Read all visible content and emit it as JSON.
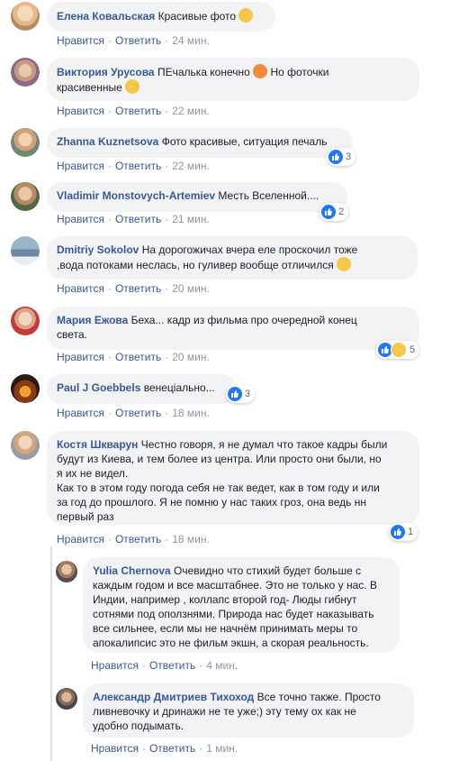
{
  "comments": [
    {
      "author": "Елена Ковальская",
      "text": "Красивые фото",
      "emoji": "slightly-smiling-emoji",
      "like": "Нравится",
      "reply": "Ответить",
      "time": "24 мин."
    },
    {
      "author": "Виктория Урусова",
      "text": "ПЕчалька конечно",
      "text2": "Но фоточки",
      "text3": "красивенные",
      "emoji": "persevering-emoji",
      "emoji2": "grinning-emoji",
      "like": "Нравится",
      "reply": "Ответить",
      "time": "22 мин."
    },
    {
      "author": "Zhanna Kuznetsova",
      "text": "Фото красивые, ситуация печаль",
      "like": "Нравится",
      "reply": "Ответить",
      "time": "22 мин.",
      "reactions": "3"
    },
    {
      "author": "Vladimir Monstovych-Artemiev",
      "text": "Месть Вселенной....",
      "like": "Нравится",
      "reply": "Ответить",
      "time": "21 мин.",
      "reactions": "2"
    },
    {
      "author": "Dmitriy Sokolov",
      "text": "На дорогожичах вчера еле проскочил тоже",
      "text2": ",вода потоками неслась, но гуливер вообще отличился",
      "emoji": "confused-emoji",
      "like": "Нравится",
      "reply": "Ответить",
      "time": "20 мин."
    },
    {
      "author": "Мария Ежова",
      "text": "Беха... кадр из фильма про очередной конец",
      "text2": "света.",
      "like": "Нравится",
      "reply": "Ответить",
      "time": "20 мин.",
      "reactions": "5"
    },
    {
      "author": "Paul J Goebbels",
      "text": "венеціально...",
      "like": "Нравится",
      "reply": "Ответить",
      "time": "18 мин.",
      "reactions": "3"
    },
    {
      "author": "Костя Шкварун",
      "lines": [
        "Честно говоря, я не думал что такое кадры были",
        "будут из Киева, и тем более из центра. Или просто они были, но",
        "я их не видел.",
        "Как то в этом году погода себя не так ведет, как в том году и или",
        "за год до прошлого. Я не помню у нас таких гроз, она ведь нн",
        "первый раз"
      ],
      "like": "Нравится",
      "reply": "Ответить",
      "time": "18 мин.",
      "reactions": "1"
    }
  ],
  "replies": [
    {
      "author": "Yulia Chernova",
      "lines": [
        "Очевидно что стихий будет больше с",
        "каждым годом и все масштабнее. Это не только у нас. В",
        "Индии, например , коллапс второй год- Люды гибнут",
        "сотнями под оползнями. Природа нас будет наказывать",
        "все сильнее, если мы не начнём принимать меры то",
        "апокалипсис это не фильм экшн, а скорая реальность."
      ],
      "like": "Нравится",
      "reply": "Ответить",
      "time": "4 мин."
    },
    {
      "author": "Александр Дмитриев Тихоход",
      "lines": [
        "Все точно также. Просто",
        "ливневочку и дринажи не те уже;) эту тему ох как не",
        "удобно подымать."
      ],
      "like": "Нравится",
      "reply": "Ответить",
      "time": "1 мин."
    }
  ],
  "separator": "·",
  "colors": {
    "author": "#385898",
    "bubble": "#f2f3f5",
    "meta": "#90949c",
    "like": "#2078f4"
  }
}
